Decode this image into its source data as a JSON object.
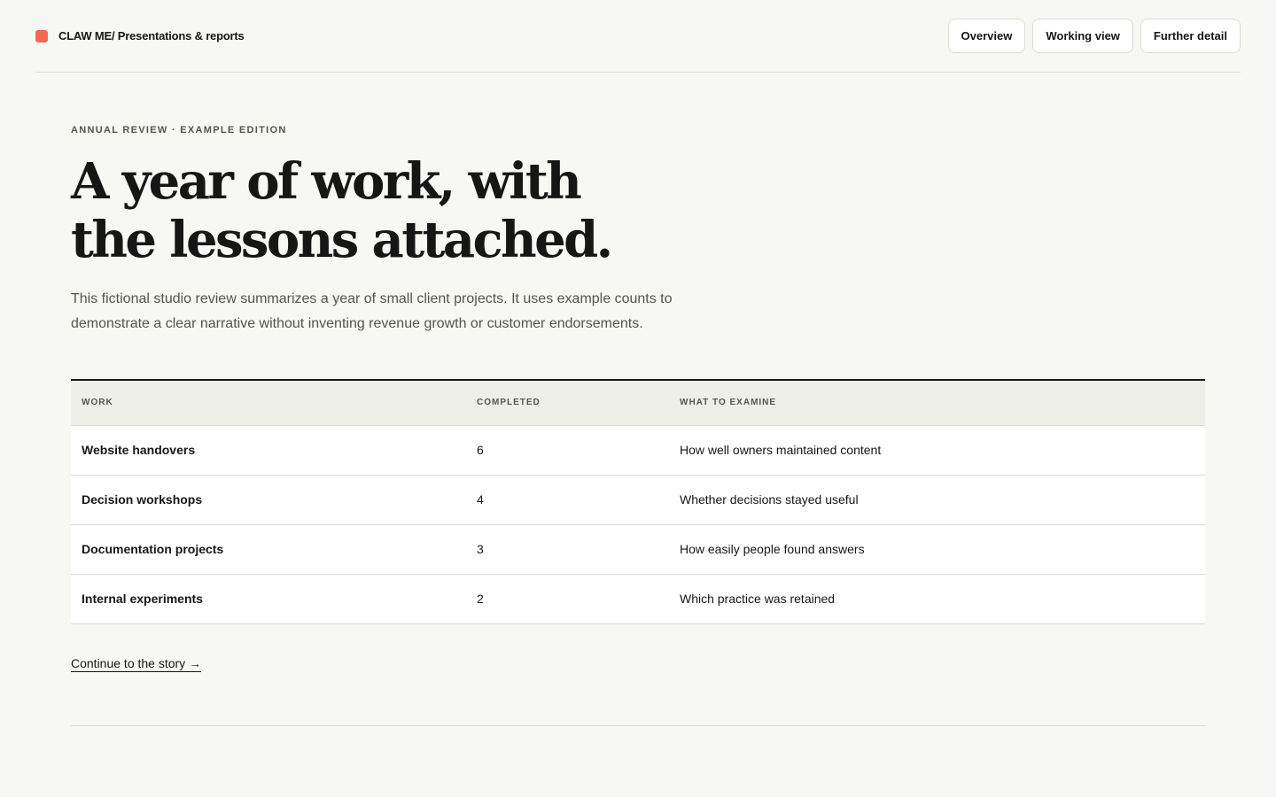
{
  "header": {
    "brand": "CLAW ME/ Presentations & reports",
    "brand_color": "#ef6a50",
    "nav": [
      {
        "label": "Overview"
      },
      {
        "label": "Working view"
      },
      {
        "label": "Further detail"
      }
    ]
  },
  "hero": {
    "eyebrow": "ANNUAL REVIEW · EXAMPLE EDITION",
    "headline_line1": "A year of work, with",
    "headline_line2": "the lessons attached.",
    "intro": "This fictional studio review summarizes a year of small client projects. It uses example counts to demonstrate a clear narrative without inventing revenue growth or customer endorsements."
  },
  "table": {
    "columns": [
      "WORK",
      "COMPLETED",
      "WHAT TO EXAMINE"
    ],
    "rows": [
      {
        "work": "Website handovers",
        "completed": "6",
        "examine": "How well owners maintained content"
      },
      {
        "work": "Decision workshops",
        "completed": "4",
        "examine": "Whether decisions stayed useful"
      },
      {
        "work": "Documentation projects",
        "completed": "3",
        "examine": "How easily people found answers"
      },
      {
        "work": "Internal experiments",
        "completed": "2",
        "examine": "Which practice was retained"
      }
    ]
  },
  "cta": {
    "label": "Continue to the story →"
  }
}
